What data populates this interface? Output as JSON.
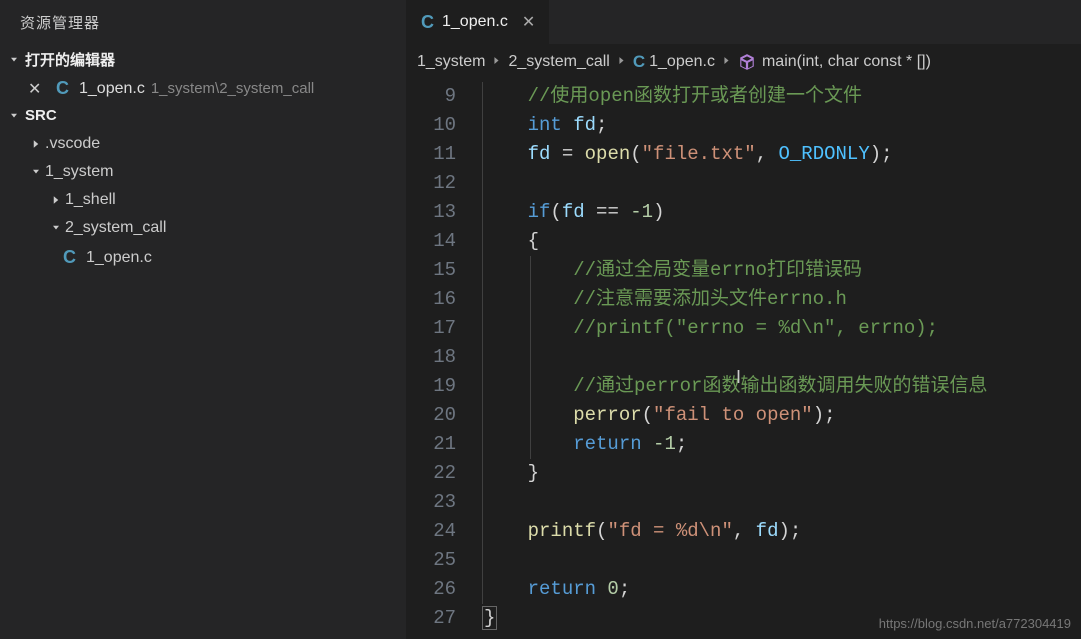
{
  "explorer": {
    "title": "资源管理器",
    "sections": {
      "open_editors_label": "打开的编辑器",
      "src_label": "SRC"
    },
    "open_editor": {
      "filename": "1_open.c",
      "path": "1_system\\2_system_call"
    },
    "tree": {
      "vscode": ".vscode",
      "system": "1_system",
      "shell": "1_shell",
      "syscall": "2_system_call",
      "openc": "1_open.c"
    }
  },
  "tabs": {
    "active": {
      "label": "1_open.c"
    }
  },
  "breadcrumbs": {
    "b0": "1_system",
    "b1": "2_system_call",
    "b2": "1_open.c",
    "b3": "main(int, char const * [])"
  },
  "code": {
    "line_numbers": [
      "9",
      "10",
      "11",
      "12",
      "13",
      "14",
      "15",
      "16",
      "17",
      "18",
      "19",
      "20",
      "21",
      "22",
      "23",
      "24",
      "25",
      "26",
      "27"
    ],
    "l9": {
      "c1": "//使用",
      "c2": "open",
      "c3": "函数打开或者创建一个文件"
    },
    "l10": {
      "k1": "int",
      "v1": " fd",
      "p1": ";"
    },
    "l11": {
      "v1": "fd",
      "o1": " = ",
      "f1": "open",
      "p1": "(",
      "s1": "\"file.txt\"",
      "p2": ", ",
      "m1": "O_RDONLY",
      "p3": ");"
    },
    "l13": {
      "k1": "if",
      "p1": "(",
      "v1": "fd",
      "o1": " == ",
      "n1": "-1",
      "p2": ")"
    },
    "l14": {
      "p1": "{"
    },
    "l15": {
      "c1": "//通过全局变量",
      "c2": "errno",
      "c3": "打印错误码"
    },
    "l16": {
      "c1": "//注意需要添加头文件",
      "c2": "errno.h"
    },
    "l17": {
      "c1": "//printf(\"errno = %d\\n\", errno);"
    },
    "l19": {
      "c1": "//通过",
      "c2": "perror",
      "c3": "函数输出函数调用失败的错误信息"
    },
    "l20": {
      "f1": "perror",
      "p1": "(",
      "s1": "\"fail to open\"",
      "p2": ");"
    },
    "l21": {
      "k1": "return",
      "n1": " -1",
      "p1": ";"
    },
    "l22": {
      "p1": "}"
    },
    "l24": {
      "f1": "printf",
      "p1": "(",
      "s1": "\"fd = %d\\n\"",
      "p2": ", ",
      "v1": "fd",
      "p3": ");"
    },
    "l26": {
      "k1": "return",
      "n1": " 0",
      "p1": ";"
    },
    "l27": {
      "p1": "}"
    }
  },
  "watermark": "https://blog.csdn.net/a772304419"
}
